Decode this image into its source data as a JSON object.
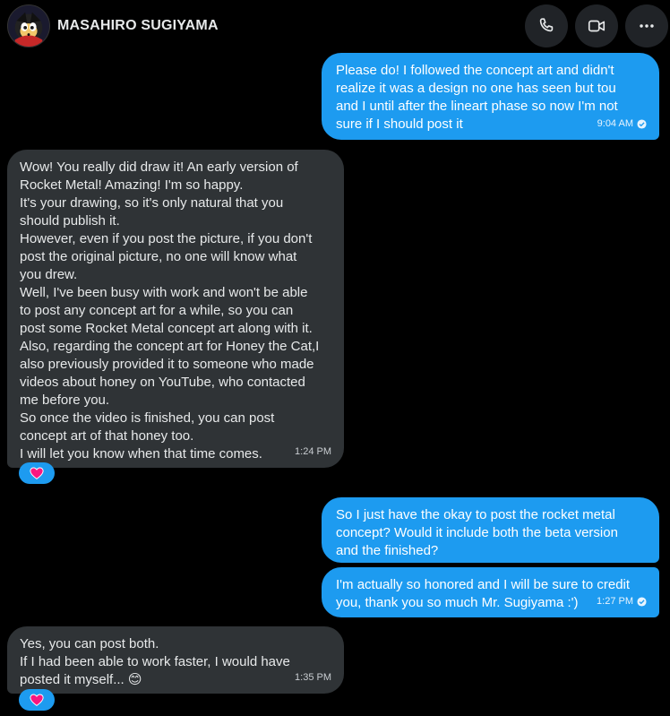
{
  "header": {
    "contact_name": "MASAHIRO SUGIYAMA",
    "avatar_icon": "sonic-style-avatar",
    "buttons": [
      {
        "name": "call-button",
        "icon": "phone-icon"
      },
      {
        "name": "video-call-button",
        "icon": "video-camera-icon"
      },
      {
        "name": "more-options-button",
        "icon": "more-horizontal-icon"
      }
    ]
  },
  "colors": {
    "outgoing_bubble": "#1d9bf0",
    "incoming_bubble": "#2f3336",
    "background": "#000000",
    "reaction_heart": "#f91880"
  },
  "messages": [
    {
      "direction": "outgoing",
      "text": "Please do! I followed the concept art and didn't\nrealize it was a design no one has seen but tou\nand I until after the lineart phase so now I'm not\nsure if I should post it",
      "time": "9:04 AM",
      "read": true
    },
    {
      "direction": "incoming",
      "text": "Wow! You really did draw it! An early version of\nRocket Metal! Amazing! I'm so happy.\nIt's your drawing, so it's only natural that you\nshould publish it.\nHowever, even if you post the picture, if you don't\npost the original picture, no one will know what\nyou drew.\nWell, I've been busy with work and won't be able\nto post any concept art for a while, so you can\npost some Rocket Metal concept art along with it.\nAlso, regarding the concept art for Honey the Cat,I\nalso previously provided it to someone who made\nvideos about honey on YouTube, who contacted\nme before you.\nSo once the video is finished, you can post\nconcept art of that honey too.\nI will let you know when that time comes.",
      "time": "1:24 PM",
      "reaction": "heart-icon"
    },
    {
      "direction": "outgoing",
      "text": "So I just have the okay to post the rocket metal\nconcept? Would it include both the beta version\nand the finished?",
      "time": ""
    },
    {
      "direction": "outgoing",
      "text": "I'm actually so honored and I will be sure to credit\nyou, thank you so much Mr. Sugiyama :')",
      "time": "1:27 PM",
      "read": true
    },
    {
      "direction": "incoming",
      "text": "Yes, you can post both.\nIf I had been able to work faster, I would have\nposted it myself... 😊",
      "time": "1:35 PM",
      "reaction": "heart-icon"
    }
  ]
}
